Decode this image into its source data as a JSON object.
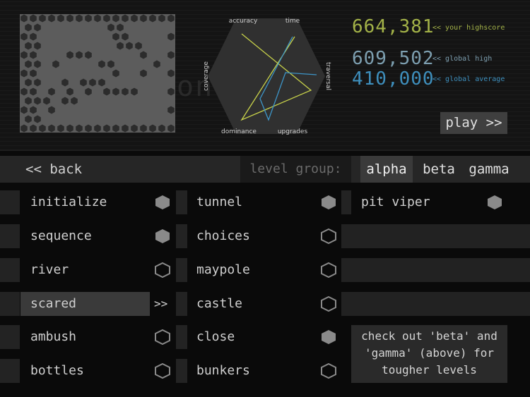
{
  "scores": {
    "your_highscore": "664,381",
    "your_highscore_label": "<< your highscore",
    "global_high": "609,502",
    "global_high_label": "<< global high",
    "global_average": "410,000",
    "global_average_label": "<< global average"
  },
  "radar": {
    "axes": [
      "accuracy",
      "time",
      "traversal",
      "upgrades",
      "dominance",
      "coverage"
    ]
  },
  "ghost_text": "on : 27",
  "play_label": "play >>",
  "nav": {
    "back_label": "<< back",
    "level_group_label": "level group:",
    "groups": [
      "alpha",
      "beta",
      "gamma"
    ]
  },
  "levels": {
    "col1": [
      "initialize",
      "sequence",
      "river",
      "scared",
      "ambush",
      "bottles"
    ],
    "col2": [
      "tunnel",
      "choices",
      "maypole",
      "castle",
      "close",
      "bunkers"
    ],
    "col3": [
      "pit viper"
    ]
  },
  "selected_arrow": ">>",
  "tip": "check out 'beta' and 'gamma' (above) for tougher levels",
  "colors": {
    "your_highscore": "#a3b248",
    "global_high": "#7d9fb0",
    "global_average": "#3e8fbd",
    "radar_yellow": "#c8d24a",
    "radar_blue": "#3d95c8",
    "hex_filled": "#8a8a8a",
    "hex_outline": "#8a8a8a"
  }
}
